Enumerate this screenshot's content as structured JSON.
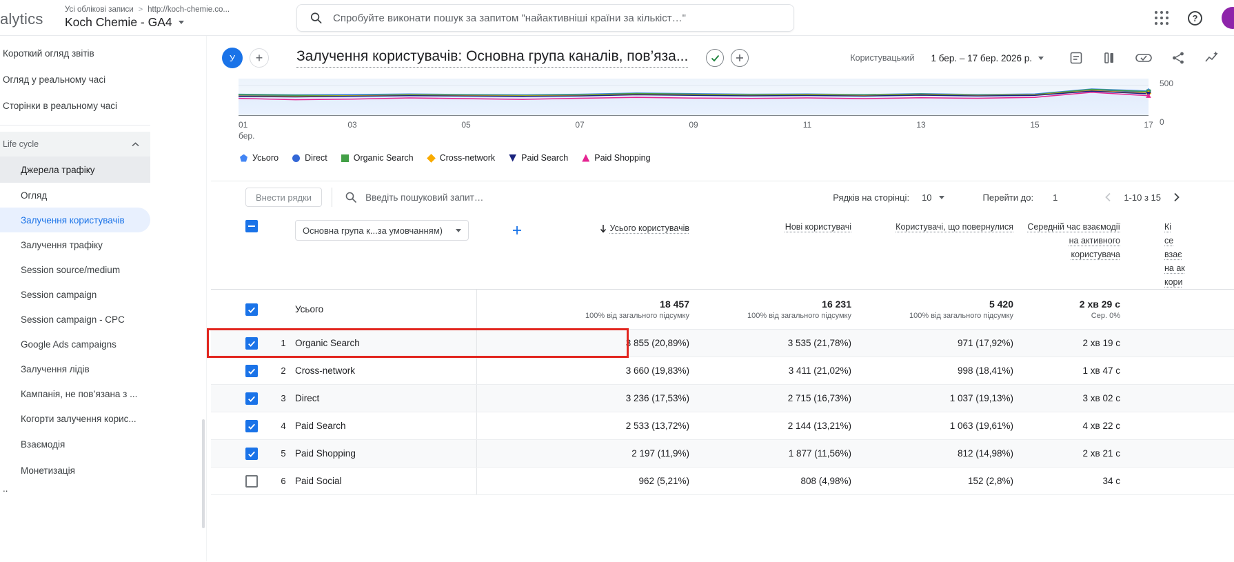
{
  "topbar": {
    "logo_text": "alytics",
    "breadcrumb_accounts": "Усі облікові записи",
    "breadcrumb_property": "http://koch-chemie.co...",
    "property_name": "Koch Chemie - GA4",
    "search_placeholder": "Спробуйте виконати пошук за запитом \"найактивніші країни за кількіст…\""
  },
  "sidebar": {
    "top_items": [
      "Короткий огляд звітів",
      "Огляд у реальному часі",
      "Сторінки в реальному часі"
    ],
    "section_label": "Life cycle",
    "topic_label": "Джерела трафіку",
    "group_items": [
      "Огляд",
      "Залучення користувачів",
      "Залучення трафіку",
      "Session source/medium",
      "Session campaign",
      "Session campaign - CPC",
      "Google Ads campaigns",
      "Залучення лідів",
      "Кампанія, не пов’язана з ...",
      "Когорти залучення корис..."
    ],
    "selected_item": "Залучення користувачів",
    "bottom_items": [
      "Взаємодія",
      "Монетизація"
    ],
    "partial_item": ".."
  },
  "report": {
    "avatar_letter": "У",
    "title": "Залучення користувачів: Основна група каналів, пов’яза...",
    "custom_label": "Користувацький",
    "date_range": "1 бер. – 17 бер. 2026 р."
  },
  "chart_data": {
    "type": "line",
    "x": [
      1,
      2,
      3,
      4,
      5,
      6,
      7,
      8,
      9,
      10,
      11,
      12,
      13,
      14,
      15,
      16,
      17
    ],
    "xtick_labels": [
      "01\nбер.",
      "03",
      "05",
      "07",
      "09",
      "11",
      "13",
      "15",
      "17"
    ],
    "ytick_labels": [
      "500",
      "0"
    ],
    "ylim": [
      0,
      620
    ],
    "gridline_value": 500,
    "legend_position": "bottom",
    "series": [
      {
        "name": "Усього",
        "color": "#4285f4",
        "shape": "pentagon",
        "values": [
          355,
          345,
          350,
          360,
          350,
          345,
          355,
          375,
          365,
          355,
          360,
          350,
          365,
          350,
          360,
          445,
          410
        ]
      },
      {
        "name": "Direct",
        "color": "#3367d6",
        "shape": "circle",
        "values": [
          335,
          328,
          335,
          345,
          338,
          332,
          340,
          360,
          350,
          342,
          348,
          338,
          352,
          342,
          350,
          430,
          390
        ]
      },
      {
        "name": "Organic Search",
        "color": "#43a047",
        "shape": "square",
        "values": [
          348,
          338,
          332,
          350,
          342,
          336,
          345,
          368,
          356,
          348,
          354,
          344,
          360,
          340,
          350,
          438,
          400
        ]
      },
      {
        "name": "Cross-network",
        "color": "#f9ab00",
        "shape": "diamond",
        "values": [
          325,
          318,
          326,
          336,
          330,
          324,
          332,
          352,
          342,
          334,
          340,
          330,
          346,
          332,
          342,
          415,
          372
        ]
      },
      {
        "name": "Paid Search",
        "color": "#1a237e",
        "shape": "triangle-down",
        "values": [
          318,
          310,
          320,
          330,
          324,
          318,
          326,
          346,
          336,
          328,
          334,
          324,
          340,
          326,
          336,
          408,
          362
        ]
      },
      {
        "name": "Paid Shopping",
        "color": "#e52592",
        "shape": "triangle-up",
        "values": [
          285,
          262,
          272,
          292,
          280,
          268,
          286,
          302,
          290,
          284,
          292,
          280,
          296,
          286,
          302,
          388,
          330
        ]
      }
    ]
  },
  "table": {
    "toolbar": {
      "import_rows_button": "Внести рядки",
      "search_placeholder": "Введіть пошуковий запит…",
      "rows_per_page_label": "Рядків на сторінці:",
      "rows_per_page_value": "10",
      "go_to_label": "Перейти до:",
      "go_to_value": "1",
      "range_label": "1-10 з 15"
    },
    "select_all": "indeterminate",
    "dimension_selector": "Основна група к...за умовчанням)",
    "headers": {
      "users": "Усього користувачів",
      "new_users": "Нові користувачі",
      "returning_users": "Користувачі, що повернулися",
      "avg_engagement_time": "Середній час взаємодії на активного користувача",
      "clipped_column_lines": "Кі\nсе\nвзає\nна ак\nкори"
    },
    "totals": {
      "checkbox": "checked",
      "label": "Усього",
      "users": "18 457",
      "users_sub": "100% від загального підсумку",
      "new_users": "16 231",
      "new_users_sub": "100% від загального підсумку",
      "returning": "5 420",
      "returning_sub": "100% від загального підсумку",
      "avg_time": "2 хв 29 с",
      "avg_time_sub": "Сер. 0%"
    },
    "rows": [
      {
        "checkbox": "checked",
        "num": "1",
        "channel": "Organic Search",
        "users": "3 855 (20,89%)",
        "new_users": "3 535 (21,78%)",
        "returning": "971 (17,92%)",
        "avg_time": "2 хв 19 с"
      },
      {
        "checkbox": "checked",
        "num": "2",
        "channel": "Cross-network",
        "users": "3 660 (19,83%)",
        "new_users": "3 411 (21,02%)",
        "returning": "998 (18,41%)",
        "avg_time": "1 хв 47 с"
      },
      {
        "checkbox": "checked",
        "num": "3",
        "channel": "Direct",
        "users": "3 236 (17,53%)",
        "new_users": "2 715 (16,73%)",
        "returning": "1 037 (19,13%)",
        "avg_time": "3 хв 02 с"
      },
      {
        "checkbox": "checked",
        "num": "4",
        "channel": "Paid Search",
        "users": "2 533 (13,72%)",
        "new_users": "2 144 (13,21%)",
        "returning": "1 063 (19,61%)",
        "avg_time": "4 хв 22 с"
      },
      {
        "checkbox": "checked",
        "num": "5",
        "channel": "Paid Shopping",
        "users": "2 197 (11,9%)",
        "new_users": "1 877 (11,56%)",
        "returning": "812 (14,98%)",
        "avg_time": "2 хв 21 с"
      },
      {
        "checkbox": "unchecked",
        "num": "6",
        "channel": "Paid Social",
        "users": "962 (5,21%)",
        "new_users": "808 (4,98%)",
        "returning": "152 (2,8%)",
        "avg_time": "34 с"
      }
    ]
  },
  "annotation": {
    "highlighted_row": "Organic Search",
    "color": "#e2261f"
  }
}
